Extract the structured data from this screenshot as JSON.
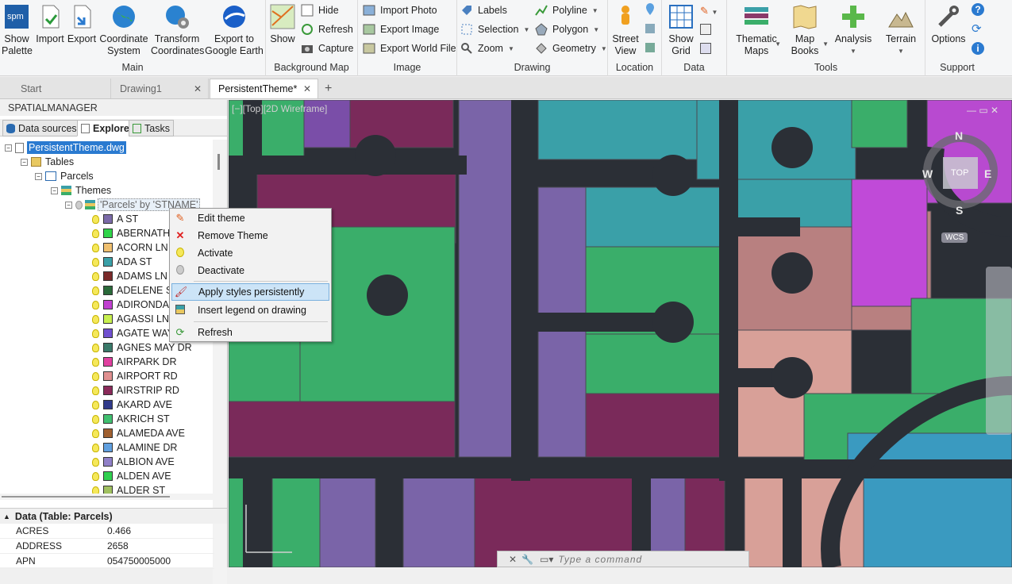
{
  "ribbon": {
    "main": {
      "title": "Main",
      "buttons": [
        {
          "label": "Show\nPalette",
          "icon": "spm-logo-icon"
        },
        {
          "label": "Import",
          "icon": "import-icon"
        },
        {
          "label": "Export",
          "icon": "export-icon"
        },
        {
          "label": "Coordinate\nSystem",
          "icon": "globe-icon"
        },
        {
          "label": "Transform\nCoordinates",
          "icon": "globe-gear-icon"
        },
        {
          "label": "Export to\nGoogle Earth",
          "icon": "google-earth-icon"
        }
      ]
    },
    "background_map": {
      "title": "Background Map",
      "show_label": "Show",
      "hide_label": "Hide",
      "refresh_label": "Refresh",
      "capture_label": "Capture"
    },
    "image": {
      "title": "Image",
      "import_photo": "Import Photo",
      "export_image": "Export Image",
      "export_world_file": "Export World File"
    },
    "drawing": {
      "title": "Drawing",
      "labels": "Labels",
      "selection": "Selection",
      "zoom": "Zoom",
      "polyline": "Polyline",
      "polygon": "Polygon",
      "geometry": "Geometry"
    },
    "location": {
      "title": "Location",
      "street_view": "Street\nView"
    },
    "data": {
      "title": "Data",
      "show_grid": "Show\nGrid"
    },
    "tools": {
      "title": "Tools",
      "thematic_maps": "Thematic\nMaps",
      "map_books": "Map\nBooks",
      "analysis": "Analysis",
      "terrain": "Terrain"
    },
    "support": {
      "title": "Support",
      "options": "Options"
    }
  },
  "tabs": [
    {
      "label": "Start",
      "active": false
    },
    {
      "label": "Drawing1",
      "active": false
    },
    {
      "label": "PersistentTheme*",
      "active": true
    }
  ],
  "panel": {
    "title": "SPATIALMANAGER",
    "tabs": [
      "Data sources",
      "Explorer",
      "Tasks"
    ],
    "tree": {
      "file": "PersistentTheme.dwg",
      "tables": "Tables",
      "parcels": "Parcels",
      "themes": "Themes",
      "theme": "'Parcels' by 'STNAME'",
      "items": [
        {
          "label": "A ST",
          "color": "#7b6aa8"
        },
        {
          "label": "ABERNATHY",
          "color": "#2fd44a"
        },
        {
          "label": "ACORN LN",
          "color": "#f0c070"
        },
        {
          "label": "ADA ST",
          "color": "#3aa0a8"
        },
        {
          "label": "ADAMS LN",
          "color": "#7a2a2a"
        },
        {
          "label": "ADELENE ST",
          "color": "#2a6a3a"
        },
        {
          "label": "ADIRONDACK",
          "color": "#c040d0"
        },
        {
          "label": "AGASSI LN",
          "color": "#c8f050"
        },
        {
          "label": "AGATE WAY",
          "color": "#7050d0"
        },
        {
          "label": "AGNES MAY DR",
          "color": "#3a7a6a"
        },
        {
          "label": "AIRPARK DR",
          "color": "#e040a0"
        },
        {
          "label": "AIRPORT RD",
          "color": "#e09090"
        },
        {
          "label": "AIRSTRIP RD",
          "color": "#8a2a5a"
        },
        {
          "label": "AKARD AVE",
          "color": "#303a8a"
        },
        {
          "label": "AKRICH ST",
          "color": "#40c070"
        },
        {
          "label": "ALAMEDA AVE",
          "color": "#a06030"
        },
        {
          "label": "ALAMINE DR",
          "color": "#60a0e0"
        },
        {
          "label": "ALBION AVE",
          "color": "#9080c8"
        },
        {
          "label": "ALDEN AVE",
          "color": "#30d050"
        },
        {
          "label": "ALDER ST",
          "color": "#a0c060"
        }
      ]
    },
    "data": {
      "title": "Data (Table: Parcels)",
      "rows": [
        {
          "key": "ACRES",
          "value": "0.466"
        },
        {
          "key": "ADDRESS",
          "value": "2658"
        },
        {
          "key": "APN",
          "value": "054750005000"
        }
      ]
    }
  },
  "context_menu": {
    "items": [
      {
        "label": "Edit theme",
        "icon": "pencil-icon"
      },
      {
        "label": "Remove Theme",
        "icon": "red-x-icon"
      },
      {
        "label": "Activate",
        "icon": "bulb-on-icon"
      },
      {
        "label": "Deactivate",
        "icon": "bulb-off-icon"
      },
      {
        "label": "Apply styles persistently",
        "icon": "brush-icon",
        "highlighted": true
      },
      {
        "label": "Insert legend on drawing",
        "icon": "legend-icon"
      },
      {
        "label": "Refresh",
        "icon": "refresh-icon"
      }
    ]
  },
  "viewport": {
    "label": "[−][Top][2D Wireframe]",
    "viewcube": {
      "n": "N",
      "s": "S",
      "e": "E",
      "w": "W",
      "top": "TOP",
      "wcs": "WCS"
    },
    "command_placeholder": "Type a command"
  }
}
